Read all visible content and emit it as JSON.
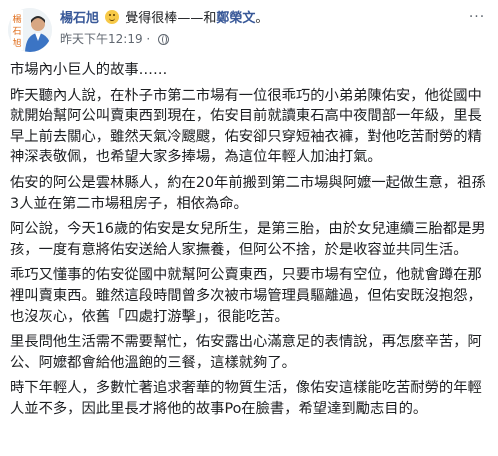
{
  "header": {
    "author": "楊石旭",
    "feeling_icon": "smiling-emoji",
    "feeling_text": "覺得很棒",
    "with_separator": "——和",
    "tagged_user": "鄭榮文",
    "period": "。",
    "timestamp": "昨天下午12:19",
    "separator": "·",
    "privacy_icon": "globe-icon",
    "avatar_text": "楊石旭"
  },
  "post": {
    "title": "市場內小巨人的故事……",
    "paragraphs": [
      "昨天聽內人說，在朴子市第二市場有一位很乖巧的小弟弟陳佑安，他從國中就開始幫阿公叫賣東西到現在，佑安目前就讀東石高中夜間部一年級，里長早上前去關心，雖然天氣冷颼颼，佑安卻只穿短袖衣褲，對他吃苦耐勞的精神深表敬佩，也希望大家多捧場，為這位年輕人加油打氣。",
      "佑安的阿公是雲林縣人，約在20年前搬到第二市場與阿嬤一起做生意，祖孫3人並在第二市場租房子，相依為命。",
      "阿公說，今天16歲的佑安是女兒所生，是第三胎，由於女兒連續三胎都是男孩，一度有意將佑安送給人家撫養，但阿公不捨，於是收容並共同生活。",
      "乖巧又懂事的佑安從國中就幫阿公賣東西，只要市場有空位，他就會蹲在那裡叫賣東西。雖然這段時間曾多次被市場管理員驅離過，但佑安既沒抱怨，也沒灰心，依舊「四處打游擊」，很能吃苦。",
      "里長問他生活需不需要幫忙，佑安露出心滿意足的表情說，再怎麼辛苦，阿公、阿嬤都會給他溫飽的三餐，這樣就夠了。",
      "時下年輕人，多數忙著追求奢華的物質生活，像佑安這樣能吃苦耐勞的年輕人並不多，因此里長才將他的故事Po在臉書，希望達到勵志目的。"
    ]
  }
}
